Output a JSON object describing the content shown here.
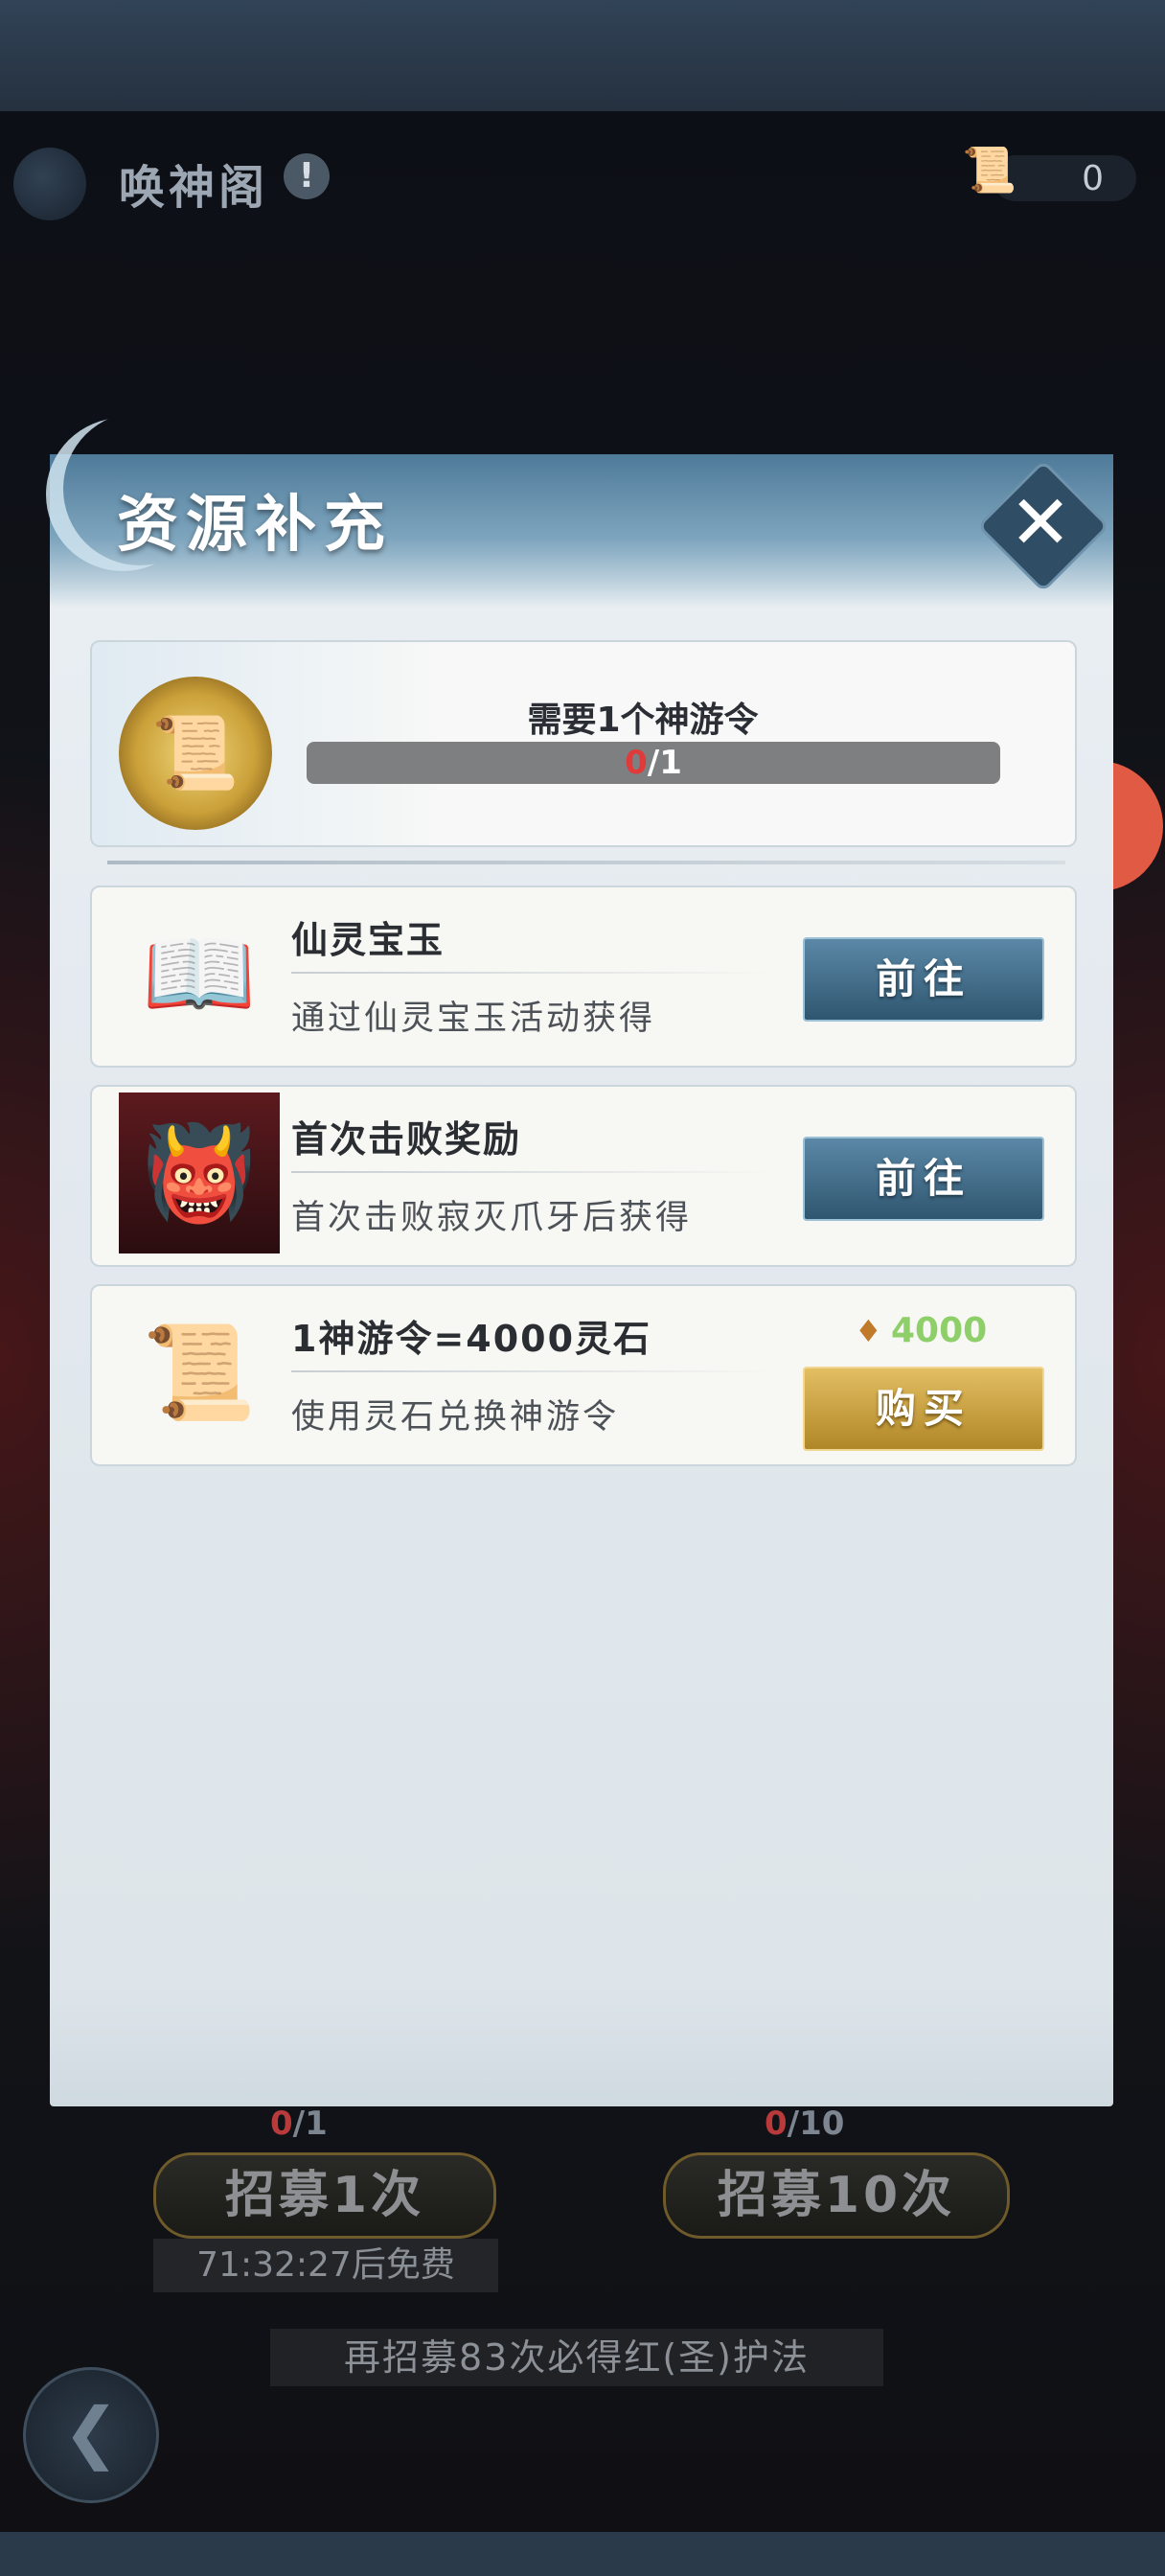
{
  "hall": {
    "title": "唤神阁",
    "info_icon": "!",
    "currency_value": "0"
  },
  "dialog": {
    "title": "资源补充",
    "close_label": "✕",
    "need": {
      "label": "需要1个神游令",
      "current": "0",
      "total": "/1",
      "progress": 0.0
    },
    "rows": [
      {
        "title": "仙灵宝玉",
        "desc": "通过仙灵宝玉活动获得",
        "button": "前往",
        "icon": "scroll-icon"
      },
      {
        "title": "首次击败奖励",
        "desc": "首次击败寂灭爪牙后获得",
        "button": "前往",
        "icon": "demon-portrait-icon"
      },
      {
        "title": "1神游令=4000灵石",
        "desc": "使用灵石兑换神游令",
        "button": "购买",
        "price": "4000",
        "icon": "token-icon"
      }
    ]
  },
  "recruit": {
    "single": {
      "count_current": "0",
      "count_total": "/1",
      "label": "招募1次",
      "timer": "71:32:27后免费"
    },
    "ten": {
      "count_current": "0",
      "count_total": "/10",
      "label": "招募10次"
    },
    "guarantee": "再招募83次必得红(圣)护法"
  }
}
